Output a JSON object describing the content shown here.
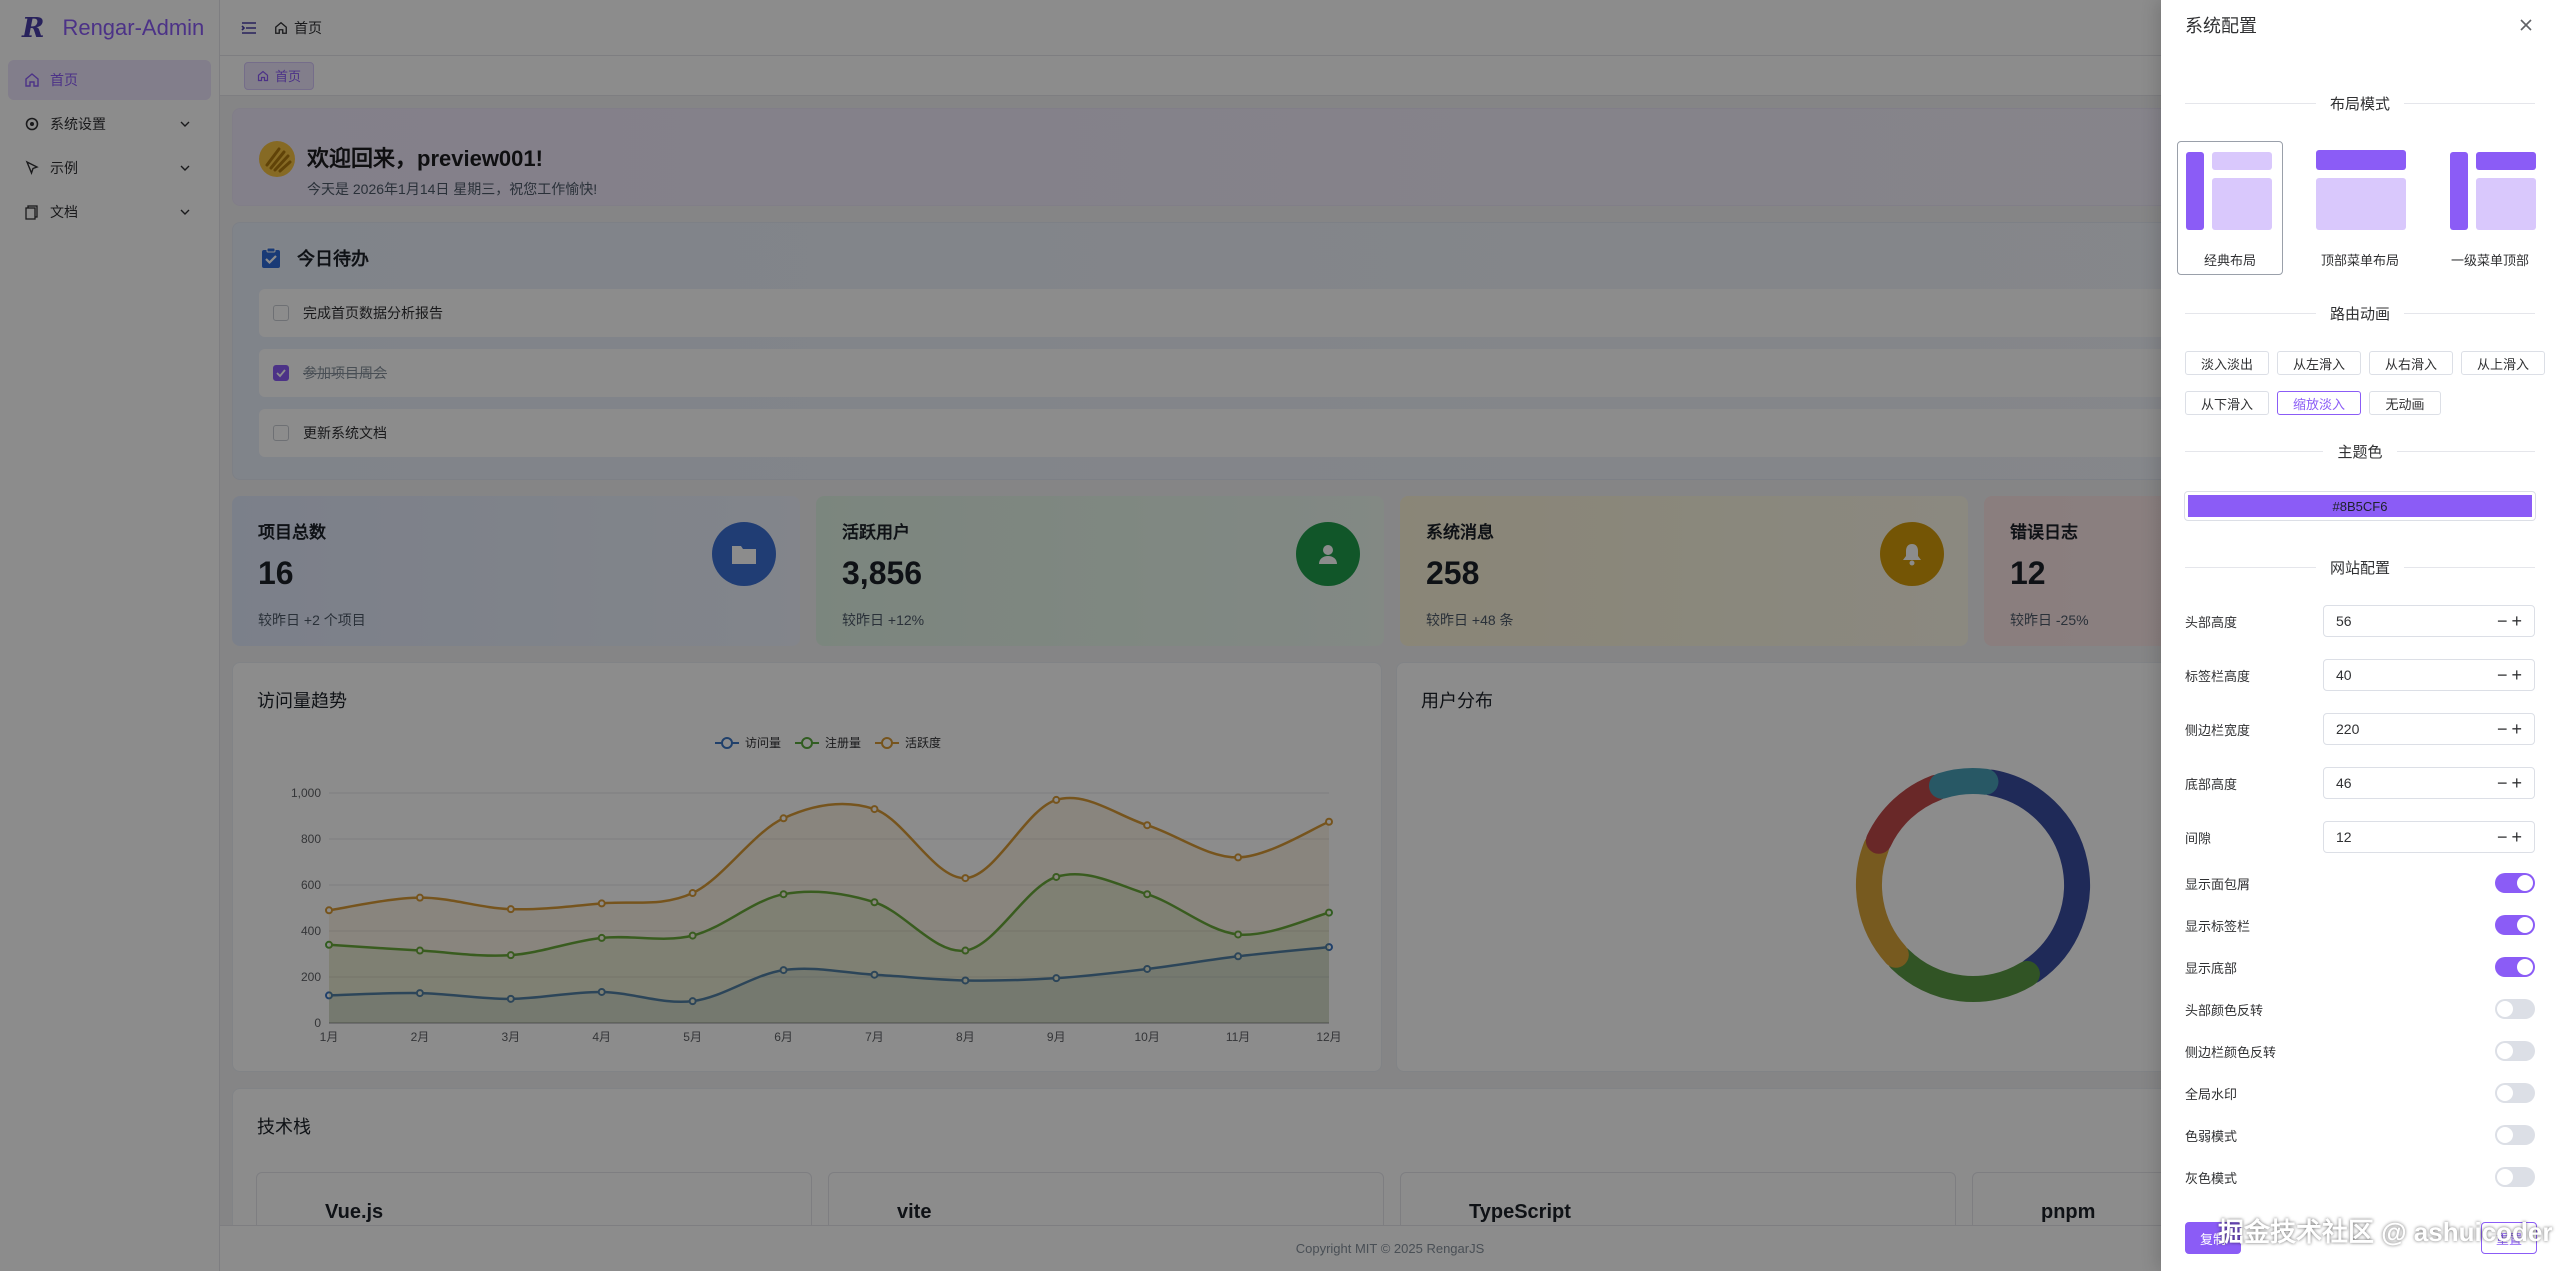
{
  "app": {
    "logo_mark": "R",
    "logo_text": "Rengar-Admin"
  },
  "sidebar": {
    "items": [
      {
        "label": "首页",
        "icon": "home-icon",
        "active": true
      },
      {
        "label": "系统设置",
        "icon": "gear-icon"
      },
      {
        "label": "示例",
        "icon": "cursor-icon"
      },
      {
        "label": "文档",
        "icon": "document-icon"
      }
    ]
  },
  "header": {
    "breadcrumb": "首页"
  },
  "tags": {
    "active": "首页"
  },
  "welcome": {
    "title": "欢迎回来，preview001!",
    "subtitle": "今天是 2026年1月14日 星期三，祝您工作愉快!"
  },
  "todo": {
    "title": "今日待办",
    "items": [
      {
        "text": "完成首页数据分析报告",
        "done": false
      },
      {
        "text": "参加项目周会",
        "done": true
      },
      {
        "text": "更新系统文档",
        "done": false
      }
    ]
  },
  "stats": [
    {
      "title": "项目总数",
      "value": "16",
      "sub": "较昨日 +2 个项目",
      "color": "#3b6fd4",
      "icon": "folder-icon"
    },
    {
      "title": "活跃用户",
      "value": "3,856",
      "sub": "较昨日 +12%",
      "color": "#1f9d4c",
      "icon": "user-icon"
    },
    {
      "title": "系统消息",
      "value": "258",
      "sub": "较昨日 +48 条",
      "color": "#d49b0a",
      "icon": "bell-icon"
    },
    {
      "title": "错误日志",
      "value": "12",
      "sub": "较昨日 -25%",
      "color": "#e06060",
      "icon": "alert-icon"
    }
  ],
  "visit_panel": {
    "title": "访问量趋势"
  },
  "dist_panel": {
    "title": "用户分布"
  },
  "tech": {
    "title": "技术栈",
    "items": [
      "Vue.js",
      "vite",
      "TypeScript",
      "pnpm"
    ]
  },
  "footer": {
    "copyright": "Copyright MIT © 2025 RengarJS"
  },
  "chart_data": [
    {
      "type": "line",
      "title": "",
      "categories": [
        "1月",
        "2月",
        "3月",
        "4月",
        "5月",
        "6月",
        "7月",
        "8月",
        "9月",
        "10月",
        "11月",
        "12月"
      ],
      "ylim": [
        0,
        1000
      ],
      "yticks": [
        "0",
        "200",
        "400",
        "600",
        "800",
        "1,000"
      ],
      "grid": true,
      "legend": "top-center",
      "series": [
        {
          "name": "访问量",
          "color": "#3b75c4",
          "values": [
            120,
            130,
            105,
            135,
            95,
            230,
            210,
            185,
            195,
            235,
            290,
            330
          ]
        },
        {
          "name": "注册量",
          "color": "#5aaa3c",
          "values": [
            340,
            315,
            295,
            370,
            380,
            560,
            525,
            315,
            635,
            560,
            385,
            480
          ]
        },
        {
          "name": "活跃度",
          "color": "#d89a35",
          "values": [
            490,
            545,
            495,
            520,
            565,
            890,
            930,
            630,
            970,
            860,
            720,
            875
          ]
        }
      ]
    },
    {
      "type": "pie",
      "title": "",
      "series": [
        {
          "name": "",
          "values": [
            35,
            20,
            17,
            12,
            7
          ]
        }
      ],
      "colors": [
        "#3a4ea0",
        "#5a9a44",
        "#d9a43a",
        "#c04a4a",
        "#4aa0b8"
      ]
    }
  ],
  "settings": {
    "title": "系统配置",
    "layout_section": "布局模式",
    "layouts": [
      {
        "label": "经典布局",
        "selected": true
      },
      {
        "label": "顶部菜单布局",
        "selected": false
      },
      {
        "label": "一级菜单顶部",
        "selected": false
      }
    ],
    "anim_section": "路由动画",
    "animations": [
      {
        "label": "淡入淡出",
        "selected": false
      },
      {
        "label": "从左滑入",
        "selected": false
      },
      {
        "label": "从右滑入",
        "selected": false
      },
      {
        "label": "从上滑入",
        "selected": false
      },
      {
        "label": "从下滑入",
        "selected": false
      },
      {
        "label": "缩放淡入",
        "selected": true
      },
      {
        "label": "无动画",
        "selected": false
      }
    ],
    "color_section": "主题色",
    "theme_color": "#8B5CF6",
    "site_section": "网站配置",
    "numbers": [
      {
        "label": "头部高度",
        "value": "56"
      },
      {
        "label": "标签栏高度",
        "value": "40"
      },
      {
        "label": "侧边栏宽度",
        "value": "220"
      },
      {
        "label": "底部高度",
        "value": "46"
      },
      {
        "label": "间隙",
        "value": "12"
      }
    ],
    "switches": [
      {
        "label": "显示面包屑",
        "on": true
      },
      {
        "label": "显示标签栏",
        "on": true
      },
      {
        "label": "显示底部",
        "on": true
      },
      {
        "label": "头部颜色反转",
        "on": false
      },
      {
        "label": "侧边栏颜色反转",
        "on": false
      },
      {
        "label": "全局水印",
        "on": false
      },
      {
        "label": "色弱模式",
        "on": false
      },
      {
        "label": "灰色模式",
        "on": false
      }
    ],
    "copy_label": "复制",
    "reset_label": "重置"
  },
  "watermark": "掘金技术社区 @ ashuicoder"
}
